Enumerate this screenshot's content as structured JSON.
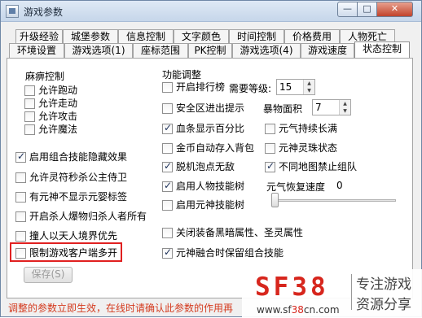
{
  "window": {
    "title": "游戏参数",
    "minimize": "—",
    "maximize": "□",
    "close": "✕"
  },
  "tabs_row1": [
    "升级经验",
    "城堡参数",
    "信息控制",
    "文字颜色",
    "时间控制",
    "价格费用",
    "人物死亡"
  ],
  "tabs_row2": [
    "环境设置",
    "游戏选项(1)",
    "座标范围",
    "PK控制",
    "游戏选项(4)",
    "游戏速度",
    "状态控制"
  ],
  "active_tab": "状态控制",
  "paralysis": {
    "title": "麻痹控制",
    "options": [
      {
        "label": "允许跑动",
        "checked": false
      },
      {
        "label": "允许走动",
        "checked": false
      },
      {
        "label": "允许攻击",
        "checked": false
      },
      {
        "label": "允许魔法",
        "checked": false
      }
    ]
  },
  "left_options": [
    {
      "label": "启用组合技能隐藏效果",
      "checked": true
    },
    {
      "label": "允许灵符秒杀公主侍卫",
      "checked": false
    },
    {
      "label": "有元神不显示元婴标签",
      "checked": false
    },
    {
      "label": "开启杀人爆物归杀人者所有",
      "checked": false
    },
    {
      "label": "撞人以天人境界优先",
      "checked": false
    },
    {
      "label": "限制游戏客户端多开",
      "checked": false
    }
  ],
  "function": {
    "title": "功能调整",
    "rank": {
      "label": "开启排行榜",
      "checked": false,
      "level_label": "需要等级:",
      "level_value": "15"
    },
    "safe_zone": {
      "label": "安全区进出提示",
      "checked": false
    },
    "storm_area": {
      "label": "暴物面积",
      "value": "7"
    },
    "hp_percent": {
      "label": "血条显示百分比",
      "checked": true
    },
    "qi_full": {
      "label": "元气持续长满",
      "checked": false
    },
    "gold_bag": {
      "label": "金币自动存入背包",
      "checked": false
    },
    "spirit_state": {
      "label": "元神灵珠状态",
      "checked": false
    },
    "bubble": {
      "label": "脱机泡点无敌",
      "checked": true
    },
    "map_group": {
      "label": "不同地图禁止组队",
      "checked": true
    },
    "char_skill_tree": {
      "label": "启用人物技能树",
      "checked": true
    },
    "qi_recover": {
      "label": "元气恢复速度",
      "value": "0"
    },
    "spirit_skill_tree": {
      "label": "启用元神技能树",
      "checked": false
    },
    "close_equip": {
      "label": "关闭装备黑暗属性、圣灵属性",
      "checked": false
    },
    "spirit_combo": {
      "label": "元神融合时保留组合技能",
      "checked": true
    }
  },
  "save_label": "保存(S)",
  "status": "调整的参数立即生效，在线时请确认此参数的作用再",
  "watermark": {
    "logo": "SF38",
    "url_pre": "www.sf",
    "url_red": "38",
    "url_post": "cn.com",
    "tag1": "专注游戏",
    "tag2": "资源分享"
  },
  "colors": {
    "status_text": "#d43a1e",
    "highlight_border": "#e02020",
    "watermark_red": "#d7261d"
  }
}
